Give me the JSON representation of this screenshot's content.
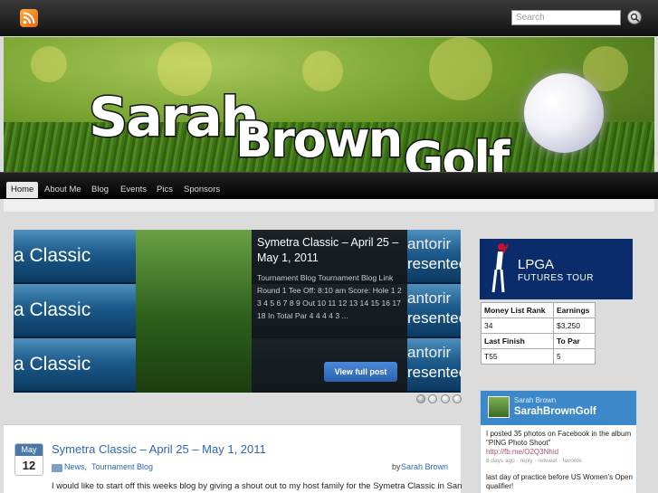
{
  "search": {
    "placeholder": "Search"
  },
  "banner": {
    "word1": "Sarah",
    "word2": "Brown",
    "word3": "Golf"
  },
  "nav": {
    "items": [
      "Home",
      "About Me",
      "Blog",
      "Events",
      "Pics",
      "Sponsors"
    ],
    "active": "Home"
  },
  "slider": {
    "left_label": "a Classic",
    "right_label_top": "antorir",
    "right_label_bottom": "resenteo",
    "title": "Symetra Classic – April 25 – May 1, 2011",
    "excerpt": "Tournament Blog Tournament Blog Link Round 1 Tee Off: 8:10 am Score: Hole 1 2 3 4 5 6 7 8 9 Out 10 11 12 13 14 15 16 17 18 In Total Par 4 4 4 4 3 ...",
    "button": "View full post",
    "slide_count": 4,
    "active_slide": 1
  },
  "post": {
    "month": "May",
    "day": "12",
    "title": "Symetra Classic – April 25 – May 1, 2011",
    "categories": [
      "News",
      "Tournament Blog"
    ],
    "by": "by",
    "author": "Sarah Brown",
    "excerpt": "I would like to start off this weeks blog by giving a shout out to my host family for the Symetra Classic in San"
  },
  "lpga": {
    "line1": "LPGA",
    "line2": "FUTURES TOUR"
  },
  "stats": {
    "headers1": [
      "Money List Rank",
      "Earnings"
    ],
    "row1": [
      "34",
      "$3,250"
    ],
    "headers2": [
      "Last Finish",
      "To Par"
    ],
    "row2": [
      "T55",
      "5"
    ]
  },
  "twitter": {
    "name": "Sarah Brown",
    "handle": "SarahBrownGolf",
    "tweet1": "I posted 35 photos on Facebook in the album \"PING Photo Shoot\"",
    "tweet1_link": "http://fb.me/O2Q3Nhid",
    "tweet1_meta": "6 days ago · reply · retweet · favorite",
    "tweet2": "last day of practice before US Women's Open qualifier!"
  },
  "colors": {
    "link": "#2d67b3",
    "nav_bg": "#000000",
    "twitter_head": "#3c88c8",
    "lpga_bg": "#0b2c6b",
    "button": "#2b63b0"
  }
}
